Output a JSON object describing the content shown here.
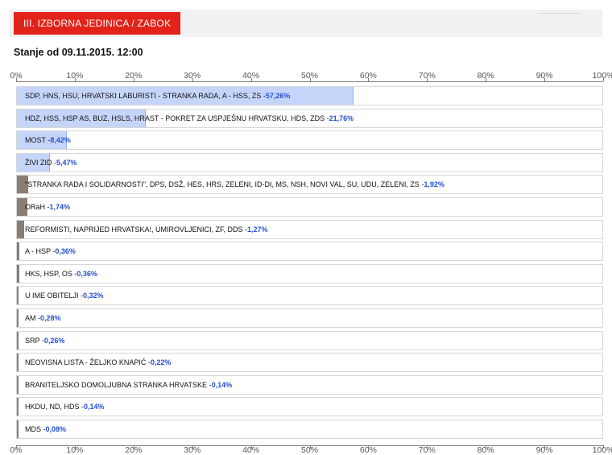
{
  "header": {
    "unit_label": "III. IZBORNA JEDINICA  / ZABOK",
    "status_text": "Stanje od 09.11.2015. 12:00"
  },
  "colors": {
    "major_bar": "#c5d5fa",
    "major_bar_border": "#93abe8",
    "minor_bar": "#8a7d74",
    "value_text": "#2450d4",
    "badge": "#e2231a"
  },
  "chart_data": {
    "type": "bar",
    "orientation": "horizontal",
    "xlim": [
      0,
      100
    ],
    "ticks": [
      "0%",
      "10%",
      "20%",
      "30%",
      "40%",
      "50%",
      "60%",
      "70%",
      "80%",
      "90%",
      "100%"
    ],
    "grid": false,
    "categories": [
      "SDP, HNS, HSU, HRVATSKI LABURISTI - STRANKA RADA, A - HSS, ZS",
      "HDZ, HSS, HSP AS, BUZ, HSLS, HRAST - POKRET ZA USPJEŠNU HRVATSKU, HDS, ZDS",
      "MOST",
      "ŽIVI ZID",
      "\"STRANKA RADA I SOLIDARNOSTI\", DPS, DSŽ, HES, HRS, ZELENI, ID-DI, MS, NSH, NOVI VAL, SU, UDU, ZELENI, ZS",
      "ORaH",
      "REFORMISTI, NAPRIJED HRVATSKA!, UMIROVLJENICI, ZF, DDS",
      "A - HSP",
      "HKS, HSP, OS",
      "U IME OBITELJI",
      "AM",
      "SRP",
      "NEOVISNA LISTA - ŽELJKO KNAPIĆ",
      "BRANITELJSKO DOMOLJUBNA STRANKA HRVATSKE",
      "HKDU, ND, HDS",
      "MDS"
    ],
    "values": [
      57.26,
      21.76,
      8.42,
      5.47,
      1.92,
      1.74,
      1.27,
      0.36,
      0.36,
      0.32,
      0.28,
      0.26,
      0.22,
      0.14,
      0.14,
      0.08
    ],
    "value_labels": [
      "57,26%",
      "21,76%",
      "8,42%",
      "5,47%",
      "1,92%",
      "1,74%",
      "1,27%",
      "0,36%",
      "0,36%",
      "0,32%",
      "0,28%",
      "0,26%",
      "0,22%",
      "0,14%",
      "0,14%",
      "0,08%"
    ]
  }
}
